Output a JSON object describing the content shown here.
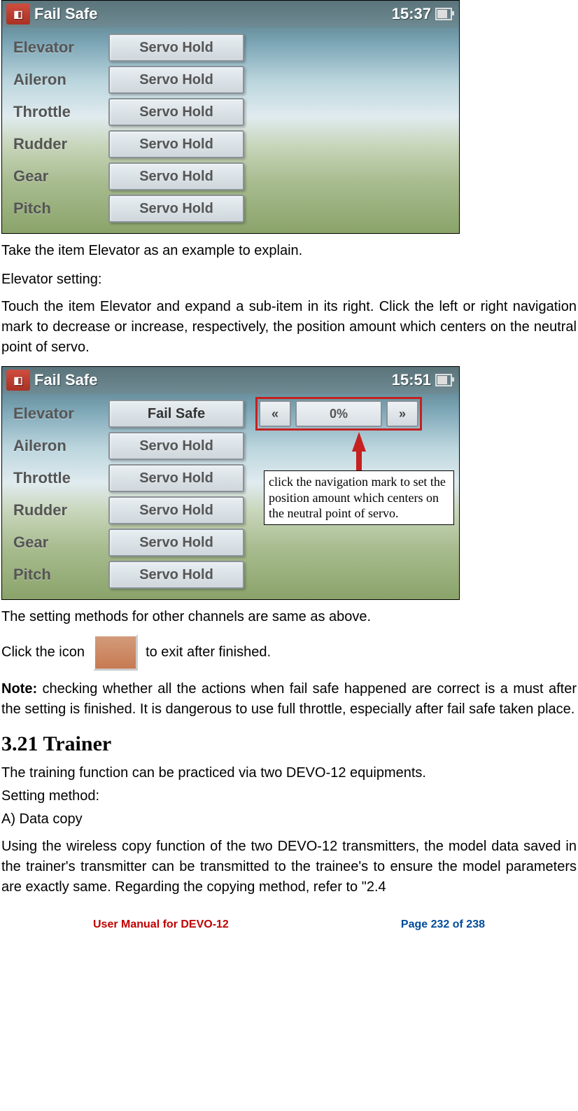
{
  "screenshot1": {
    "title": "Fail Safe",
    "time": "15:37",
    "rows": [
      {
        "label": "Elevator",
        "button": "Servo Hold"
      },
      {
        "label": "Aileron",
        "button": "Servo Hold"
      },
      {
        "label": "Throttle",
        "button": "Servo Hold"
      },
      {
        "label": "Rudder",
        "button": "Servo Hold"
      },
      {
        "label": "Gear",
        "button": "Servo Hold"
      },
      {
        "label": "Pitch",
        "button": "Servo Hold"
      }
    ]
  },
  "para1": "Take the item Elevator as an example to explain.",
  "para2": "Elevator setting:",
  "para3": "Touch the item Elevator and expand a sub-item in its right. Click the left or right navigation mark to decrease or increase, respectively, the position amount which centers on the neutral point of servo.",
  "screenshot2": {
    "title": "Fail Safe",
    "time": "15:51",
    "rows": [
      {
        "label": "Elevator",
        "button": "Fail Safe"
      },
      {
        "label": "Aileron",
        "button": "Servo Hold"
      },
      {
        "label": "Throttle",
        "button": "Servo Hold"
      },
      {
        "label": "Rudder",
        "button": "Servo Hold"
      },
      {
        "label": "Gear",
        "button": "Servo Hold"
      },
      {
        "label": "Pitch",
        "button": "Servo Hold"
      }
    ],
    "spinner_value": "0%",
    "nav_left": "«",
    "nav_right": "»",
    "annotation": "click the navigation mark to set the position amount which centers on the neutral point of servo."
  },
  "para4": "The setting methods for other channels are same as above.",
  "para5a": "Click the icon",
  "para5b": " to exit after finished.",
  "note_label": "Note:",
  "para6": " checking whether all the actions when fail safe happened are correct is a must after the setting is finished. It is dangerous to use full throttle, especially after fail safe taken place.",
  "heading": "3.21 Trainer",
  "para7": "The training function can be practiced via two DEVO-12 equipments.",
  "para8": "Setting method:",
  "para9": "A) Data copy",
  "para10": "Using the wireless copy function of the two DEVO-12 transmitters, the model data saved in the trainer's transmitter can be transmitted to the trainee's to ensure the model parameters are exactly same. Regarding the copying method, refer to \"2.4",
  "footer_left": "User Manual for DEVO-12",
  "footer_right": "Page 232 of 238"
}
